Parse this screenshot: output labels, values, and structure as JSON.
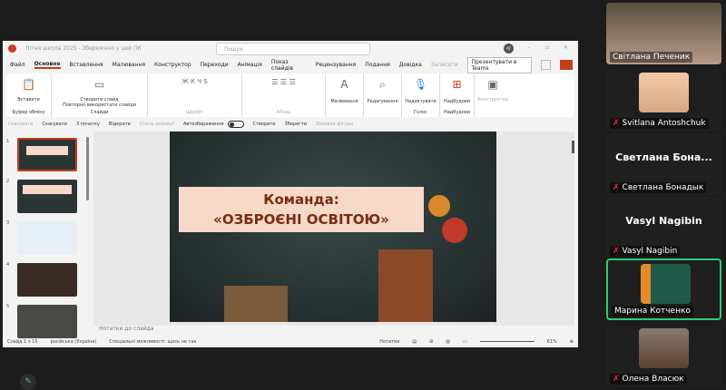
{
  "powerpoint": {
    "title": "Літня школа 2025 - Збережено у цей ПК",
    "search_placeholder": "Пошук",
    "avatar": "AT",
    "tabs": [
      "Файл",
      "Основне",
      "Вставлення",
      "Малювання",
      "Конструктор",
      "Переходи",
      "Анімація",
      "Показ слайдів",
      "Рецензування",
      "Подання",
      "Довідка"
    ],
    "record": "Записати",
    "present_teams": "Презентувати в Teams",
    "ribbon_groups": [
      {
        "label": "Буфер обміну",
        "buttons": [
          "Вставити"
        ]
      },
      {
        "label": "Слайди",
        "buttons": [
          "Створити слайд",
          "Повторно використати слайди"
        ]
      },
      {
        "label": "Шрифт",
        "buttons": []
      },
      {
        "label": "Абзац",
        "buttons": []
      },
      {
        "label": "",
        "buttons": [
          "Малювання"
        ]
      },
      {
        "label": "",
        "buttons": [
          "Редагування"
        ]
      },
      {
        "label": "Голос",
        "buttons": [
          "Надиктувати"
        ]
      },
      {
        "label": "Надбудови",
        "buttons": [
          "Надбудови"
        ]
      },
      {
        "label": "",
        "buttons": [
          "Конструктор"
        ]
      }
    ],
    "quick_toolbar": [
      "Скасувати",
      "Скасувати",
      "З початку",
      "Відкрити",
      "Стиль анімації",
      "Автозбереження",
      "Створити",
      "Зберегти",
      "Заливка фігури"
    ],
    "slide_numbers": [
      "1",
      "2",
      "3",
      "4",
      "5"
    ],
    "slide_title_line1": "Команда:",
    "slide_title_line2": "«ОЗБРОЄНІ ОСВІТОЮ»",
    "notes_placeholder": "Нотатки до слайда",
    "status": {
      "slide": "Слайд 1 з 15",
      "language": "російська (Україна)",
      "accessibility": "Спеціальні можливості: щось не так",
      "notes": "Нотатки",
      "zoom": "61%"
    }
  },
  "participants": [
    {
      "name": "Світлана Печеник",
      "muted": false,
      "video": true
    },
    {
      "name": "Svitlana Antoshchuk",
      "muted": true,
      "video": true
    },
    {
      "name": "Светлана Бонадык",
      "display": "Светлана Бона...",
      "muted": true,
      "video": false
    },
    {
      "name": "Vasyl Nagibin",
      "display": "Vasyl Nagibin",
      "muted": true,
      "video": false
    },
    {
      "name": "Марина Котченко",
      "muted": false,
      "video": true,
      "speaking": true
    },
    {
      "name": "Олена Власюк",
      "muted": true,
      "video": true
    }
  ],
  "colors": {
    "accent": "#c43e1c",
    "speaking_border": "#2ecc71",
    "muted": "#e0393e"
  }
}
